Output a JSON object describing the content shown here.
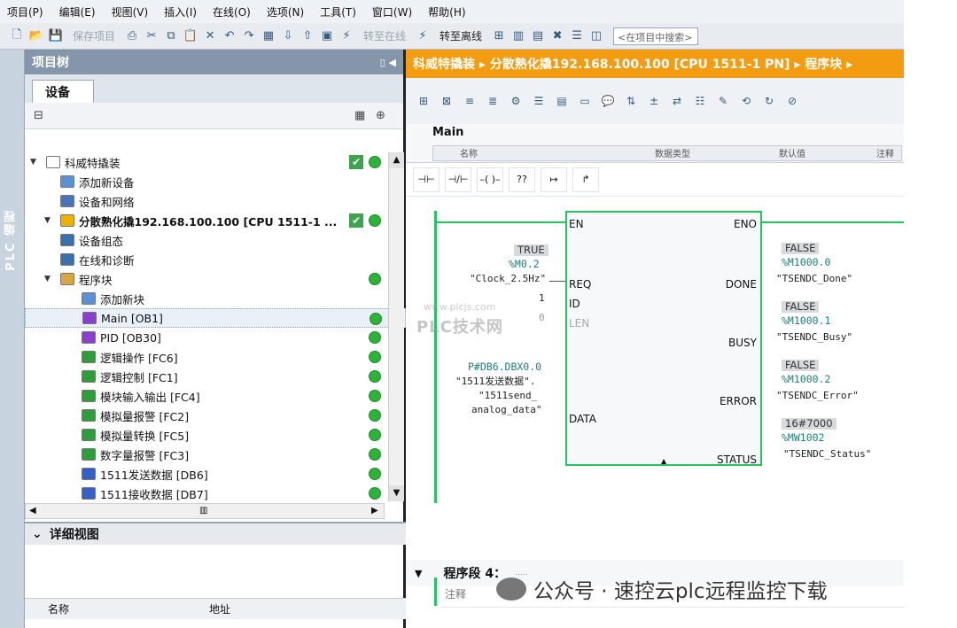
{
  "menu": [
    "项目(P)",
    "编辑(E)",
    "视图(V)",
    "插入(I)",
    "在线(O)",
    "选项(N)",
    "工具(T)",
    "窗口(W)",
    "帮助(H)"
  ],
  "toolbar": {
    "save_project": "保存项目",
    "go_online": "转至在线",
    "go_offline": "转至离线",
    "search_placeholder": "<在项目中搜索>"
  },
  "sidebar_label": "PLC 编程",
  "project_tree": {
    "title": "项目树",
    "tab": "设备",
    "items": [
      {
        "label": "科威特撬装",
        "level": 0,
        "check": true,
        "status": true,
        "color": "#ffffff"
      },
      {
        "label": "添加新设备",
        "level": 1,
        "check": false,
        "status": false,
        "color": "#5b8fd6"
      },
      {
        "label": "设备和网络",
        "level": 1,
        "check": false,
        "status": false,
        "color": "#4a74b8"
      },
      {
        "label": "分散熟化撬192.168.100.100 [CPU 1511-1 ...",
        "level": 1,
        "check": true,
        "status": true,
        "color": "#f0b000"
      },
      {
        "label": "设备组态",
        "level": 2,
        "check": false,
        "status": false,
        "color": "#3a6fb0"
      },
      {
        "label": "在线和诊断",
        "level": 2,
        "check": false,
        "status": false,
        "color": "#3a6fb0"
      },
      {
        "label": "程序块",
        "level": 2,
        "check": false,
        "status": true,
        "color": "#d9a640"
      },
      {
        "label": "添加新块",
        "level": 3,
        "check": false,
        "status": false,
        "color": "#5b8fd6"
      },
      {
        "label": "Main [OB1]",
        "level": 3,
        "check": false,
        "status": true,
        "color": "#8a3fd1",
        "selected": true
      },
      {
        "label": "PID [OB30]",
        "level": 3,
        "check": false,
        "status": true,
        "color": "#8a3fd1"
      },
      {
        "label": "逻辑操作 [FC6]",
        "level": 3,
        "check": false,
        "status": true,
        "color": "#2e9e3a"
      },
      {
        "label": "逻辑控制 [FC1]",
        "level": 3,
        "check": false,
        "status": true,
        "color": "#2e9e3a"
      },
      {
        "label": "模块输入输出 [FC4]",
        "level": 3,
        "check": false,
        "status": true,
        "color": "#2e9e3a"
      },
      {
        "label": "模拟量报警 [FC2]",
        "level": 3,
        "check": false,
        "status": true,
        "color": "#2e9e3a"
      },
      {
        "label": "模拟量转换 [FC5]",
        "level": 3,
        "check": false,
        "status": true,
        "color": "#2e9e3a"
      },
      {
        "label": "数字量报警 [FC3]",
        "level": 3,
        "check": false,
        "status": true,
        "color": "#2e9e3a"
      },
      {
        "label": "1511发送数据 [DB6]",
        "level": 3,
        "check": false,
        "status": true,
        "color": "#3560c9"
      },
      {
        "label": "1511接收数据 [DB7]",
        "level": 3,
        "check": false,
        "status": true,
        "color": "#3560c9"
      }
    ]
  },
  "detail_view": {
    "title": "详细视图",
    "col_name": "名称",
    "col_address": "地址"
  },
  "editor": {
    "breadcrumb": "科威特撬装 ▸ 分散熟化撬192.168.100.100 [CPU 1511-1 PN] ▸ 程序块 ▸",
    "block_name": "Main",
    "hdr_name": "名称",
    "hdr_type": "数据类型",
    "hdr_default": "默认值",
    "hdr_comment": "注释",
    "ladder_tools": [
      "⊣⊢",
      "⊣/⊢",
      "–( )–",
      "??",
      "↦",
      "↱"
    ],
    "fb": {
      "in_pins": [
        "EN",
        "REQ",
        "ID",
        "LEN",
        "DATA"
      ],
      "out_pins": [
        "ENO",
        "DONE",
        "BUSY",
        "ERROR",
        "STATUS"
      ],
      "req_value": "TRUE",
      "req_addr": "%M0.2",
      "req_sym": "\"Clock_2.5Hz\"",
      "id_value": "1",
      "len_value": "0",
      "data_addr": "P#DB6.DBX0.0",
      "data_sym1": "\"1511发送数据\".",
      "data_sym2": "\"1511send_",
      "data_sym3": "analog_data\"",
      "done_value": "FALSE",
      "done_addr": "%M1000.0",
      "done_sym": "\"TSENDC_Done\"",
      "busy_value": "FALSE",
      "busy_addr": "%M1000.1",
      "busy_sym": "\"TSENDC_Busy\"",
      "error_value": "FALSE",
      "error_addr": "%M1000.2",
      "error_sym": "\"TSENDC_Error\"",
      "status_value": "16#7000",
      "status_addr": "%MW1002",
      "status_sym": "\"TSENDC_Status\""
    },
    "segment": "程序段 4：",
    "segment_dots": ".....",
    "comment": "注释"
  },
  "watermark": "PLC技术网",
  "watermark_url": "www.plcjs.com",
  "footer": "公众号 · 速控云plc远程监控下载"
}
